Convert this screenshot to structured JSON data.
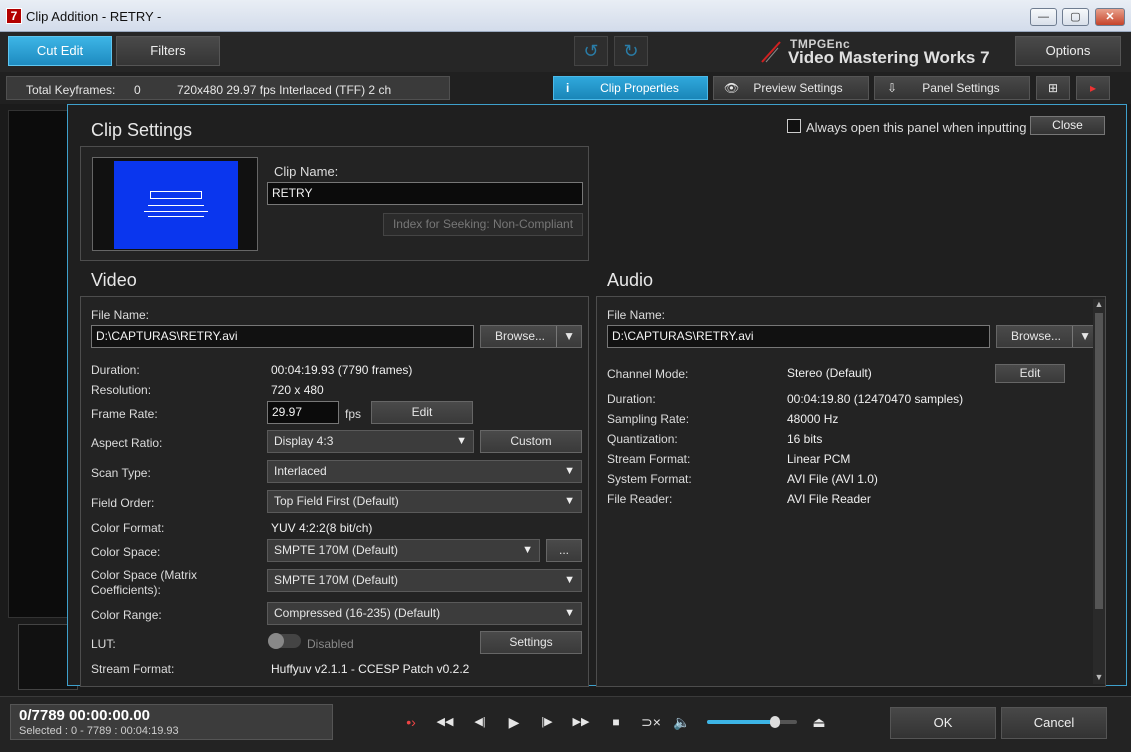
{
  "window": {
    "title": "Clip Addition - RETRY -",
    "icon_letter": "7",
    "min": "—",
    "max": "▢",
    "close": "✕"
  },
  "toolbar": {
    "cut_edit": "Cut Edit",
    "filters": "Filters",
    "undo_icon": "undo-icon",
    "redo_icon": "redo-icon",
    "options": "Options",
    "brand": "TMPGEnc",
    "product": "Video Mastering Works 7"
  },
  "infobar": {
    "total_keyframes_label": "Total Keyframes:",
    "total_keyframes_value": "0",
    "format": "720x480 29.97 fps Interlaced (TFF) 2 ch",
    "clip_properties": "Clip Properties",
    "preview_settings": "Preview Settings",
    "panel_settings": "Panel Settings"
  },
  "dialog": {
    "title": "Clip Settings",
    "always_open": "Always open this panel when inputting",
    "close": "Close",
    "clip_name_label": "Clip Name:",
    "clip_name_value": "RETRY",
    "index_seek": "Index for Seeking: Non-Compliant",
    "video": {
      "header": "Video",
      "file_name_label": "File Name:",
      "file_name_value": "D:\\CAPTURAS\\RETRY.avi",
      "browse": "Browse...",
      "duration_label": "Duration:",
      "duration_value": "00:04:19.93 (7790  frames)",
      "resolution_label": "Resolution:",
      "resolution_value": "720 x 480",
      "frame_rate_label": "Frame Rate:",
      "frame_rate_value": "29.97",
      "fps": "fps",
      "edit": "Edit",
      "aspect_label": "Aspect Ratio:",
      "aspect_value": "Display 4:3",
      "custom": "Custom",
      "scan_label": "Scan Type:",
      "scan_value": "Interlaced",
      "field_order_label": "Field Order:",
      "field_order_value": "Top Field First (Default)",
      "color_format_label": "Color Format:",
      "color_format_value": "YUV 4:2:2(8 bit/ch)",
      "color_space_label": "Color Space:",
      "color_space_value": "SMPTE 170M (Default)",
      "color_space_more": "...",
      "matrix_label_1": "Color Space (Matrix",
      "matrix_label_2": "Coefficients):",
      "matrix_value": "SMPTE 170M (Default)",
      "range_label": "Color Range:",
      "range_value": "Compressed (16-235) (Default)",
      "lut_label": "LUT:",
      "lut_state": "Disabled",
      "lut_settings": "Settings",
      "stream_label": "Stream Format:",
      "stream_value": "Huffyuv v2.1.1 - CCESP Patch v0.2.2"
    },
    "audio": {
      "header": "Audio",
      "file_name_label": "File Name:",
      "file_name_value": "D:\\CAPTURAS\\RETRY.avi",
      "browse": "Browse...",
      "channel_label": "Channel Mode:",
      "channel_value": "Stereo (Default)",
      "edit": "Edit",
      "duration_label": "Duration:",
      "duration_value": "00:04:19.80 (12470470  samples)",
      "sampling_label": "Sampling Rate:",
      "sampling_value": "48000 Hz",
      "quant_label": "Quantization:",
      "quant_value": "16 bits",
      "stream_label": "Stream Format:",
      "stream_value": "Linear PCM",
      "system_label": "System Format:",
      "system_value": "AVI File (AVI 1.0)",
      "reader_label": "File Reader:",
      "reader_value": "AVI File Reader"
    }
  },
  "bottom": {
    "timecode": "0/7789  00:00:00.00",
    "selected": "Selected : 0 - 7789 : 00:04:19.93",
    "controls": {
      "mark": "•›",
      "rewind": "◀◀",
      "step_back": "◀|",
      "play": "▶",
      "step_fwd": "|▶",
      "ffwd": "▶▶",
      "stop": "■",
      "loop": "⊃×",
      "volume": "🔈",
      "eject": "⏏"
    },
    "volume_level": 0.75,
    "ok": "OK",
    "cancel": "Cancel"
  },
  "colors": {
    "accent": "#2fa8dc",
    "thumb_blue": "#0a36ee"
  }
}
